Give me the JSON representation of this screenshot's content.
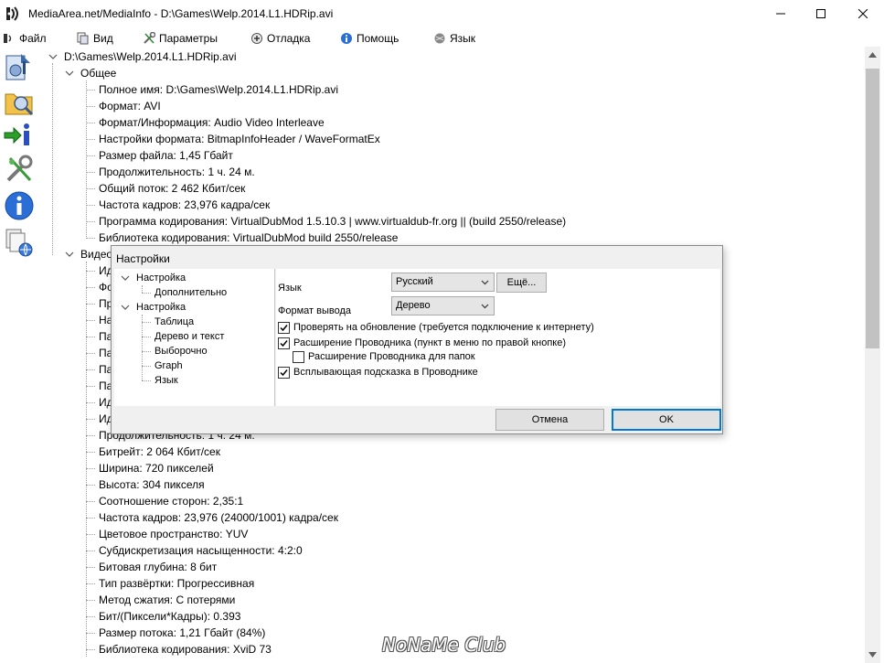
{
  "window": {
    "title": "MediaArea.net/MediaInfo - D:\\Games\\Welp.2014.L1.HDRip.avi"
  },
  "menu": [
    {
      "label": "Файл",
      "icon": "file-icon"
    },
    {
      "label": "Вид",
      "icon": "view-icon"
    },
    {
      "label": "Параметры",
      "icon": "options-icon"
    },
    {
      "label": "Отладка",
      "icon": "debug-icon"
    },
    {
      "label": "Помощь",
      "icon": "help-icon"
    },
    {
      "label": "Язык",
      "icon": "language-icon"
    }
  ],
  "toolbar": [
    {
      "icon": "open-file-icon"
    },
    {
      "icon": "open-folder-icon"
    },
    {
      "icon": "export-icon"
    },
    {
      "icon": "options-icon"
    },
    {
      "icon": "about-icon"
    },
    {
      "icon": "web-icon"
    }
  ],
  "tree": {
    "root": "D:\\Games\\Welp.2014.L1.HDRip.avi",
    "general_label": "Общее",
    "general_items": [
      "Полное имя: D:\\Games\\Welp.2014.L1.HDRip.avi",
      "Формат: AVI",
      "Формат/Информация: Audio Video Interleave",
      "Настройки формата: BitmapInfoHeader / WaveFormatEx",
      "Размер файла: 1,45 Гбайт",
      "Продолжительность: 1 ч. 24 м.",
      "Общий поток: 2 462 Кбит/сек",
      "Частота кадров: 23,976 кадра/сек",
      "Программа кодирования: VirtualDubMod 1.5.10.3 | www.virtualdub-fr.org || (build 2550/release)",
      "Библиотека кодирования: VirtualDubMod build 2550/release"
    ],
    "video_label": "Видео",
    "video_hidden_fragments": [
      "Ид",
      "Фо",
      "Пр",
      "На",
      "Па",
      "Па",
      "Па",
      "Па",
      "Ид",
      "Ид"
    ],
    "video_items": [
      "Продолжительность: 1 ч. 24 м.",
      "Битрейт: 2 064 Кбит/сек",
      "Ширина: 720 пикселей",
      "Высота: 304 пикселя",
      "Соотношение сторон: 2,35:1",
      "Частота кадров: 23,976 (24000/1001) кадра/сек",
      "Цветовое пространство: YUV",
      "Субдискретизация насыщенности: 4:2:0",
      "Битовая глубина: 8 бит",
      "Тип развёртки: Прогрессивная",
      "Метод сжатия: С потерями",
      "Бит/(Пиксели*Кадры): 0.393",
      "Размер потока: 1,21 Гбайт (84%)",
      "Библиотека кодирования: XviD 73"
    ]
  },
  "dialog": {
    "title": "Настройки",
    "tree": [
      {
        "label": "Настройка",
        "expanded": true
      },
      {
        "label": "Дополнительно"
      },
      {
        "label": "Настройка",
        "expanded": true
      },
      {
        "label": "Таблица"
      },
      {
        "label": "Дерево и текст"
      },
      {
        "label": "Выборочно"
      },
      {
        "label": "Graph"
      },
      {
        "label": "Язык"
      }
    ],
    "language_label": "Язык",
    "language_value": "Русский",
    "more_button": "Ещё...",
    "output_label": "Формат вывода",
    "output_value": "Дерево",
    "checkboxes": [
      {
        "label": "Проверять на обновление (требуется подключение к интернету)",
        "checked": true
      },
      {
        "label": "Расширение Проводника (пункт в меню по правой кнопке)",
        "checked": true
      },
      {
        "label": "Расширение Проводника для папок",
        "checked": false
      },
      {
        "label": "Всплывающая подсказка в Проводнике",
        "checked": true
      }
    ],
    "cancel_button": "Отмена",
    "ok_button": "OK"
  },
  "watermark": "NoNaMe Club"
}
